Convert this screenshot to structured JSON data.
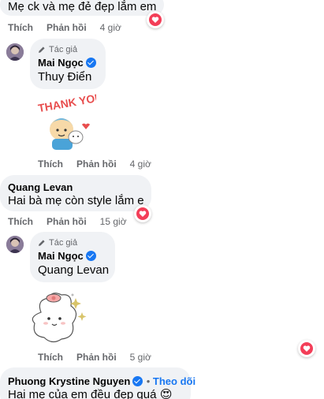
{
  "comments": [
    {
      "text": "Mẹ ck và mẹ đẻ đẹp lắm em",
      "actions": {
        "like": "Thích",
        "reply": "Phản hồi",
        "time": "4 giờ"
      },
      "reaction": "heart-icon"
    },
    {
      "author_badge": "Tác giả",
      "author": "Mai Ngọc",
      "mention": "Thuy Điển",
      "sticker": "thank-you-sticker",
      "sticker_text": "THANK YOU!",
      "actions": {
        "like": "Thích",
        "reply": "Phản hồi",
        "time": "4 giờ"
      }
    },
    {
      "author": "Quang Levan",
      "text": "Hai bà mẹ còn style lắm e",
      "actions": {
        "like": "Thích",
        "reply": "Phản hồi",
        "time": "15 giờ"
      },
      "reaction": "heart-icon"
    },
    {
      "author_badge": "Tác giả",
      "author": "Mai Ngọc",
      "mention": "Quang Levan",
      "sticker": "cute-bear-sticker",
      "actions": {
        "like": "Thích",
        "reply": "Phản hồi",
        "time": "5 giờ"
      },
      "reaction": "heart-icon"
    },
    {
      "author": "Phuong Krystine Nguyen",
      "follow": "Theo dõi",
      "text": "Hai mẹ của em đều đẹp quá",
      "emoji": "😍"
    }
  ],
  "colors": {
    "bubble": "#f0f2f5",
    "link": "#1877f2",
    "heart": "#f33e58",
    "meta": "#65676b"
  }
}
